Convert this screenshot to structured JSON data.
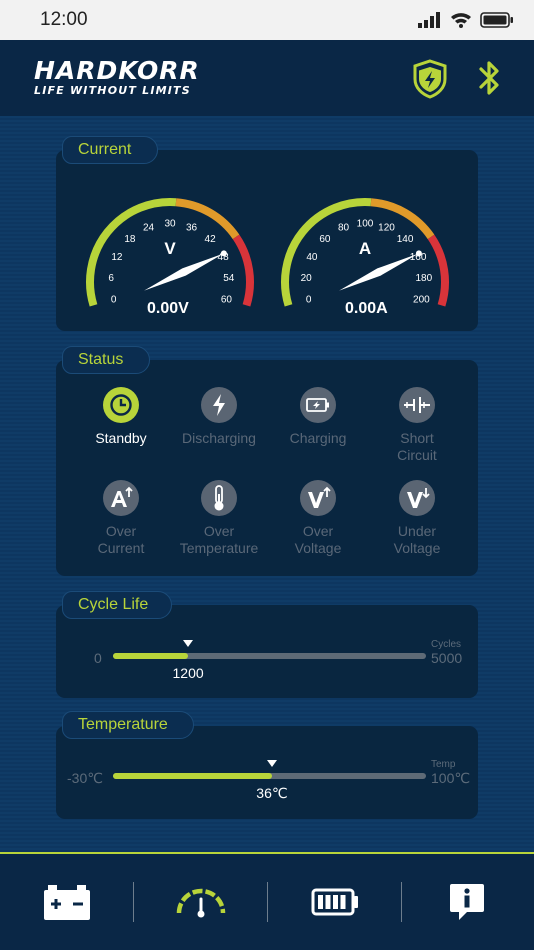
{
  "status_bar": {
    "time": "12:00"
  },
  "header": {
    "brand": "HARDKORR",
    "tagline": "LIFE WITHOUT LIMITS",
    "icons": [
      "shield-bolt-icon",
      "bluetooth-icon"
    ],
    "accent": "#b8d43a"
  },
  "current": {
    "title": "Current",
    "voltage": {
      "unit": "V",
      "ticks": [
        "0",
        "6",
        "12",
        "18",
        "24",
        "30",
        "36",
        "42",
        "48",
        "54",
        "60"
      ],
      "value": 0,
      "max": 60,
      "readout": "0.00V"
    },
    "amperage": {
      "unit": "A",
      "ticks": [
        "0",
        "20",
        "40",
        "60",
        "80",
        "100",
        "120",
        "140",
        "160",
        "180",
        "200"
      ],
      "value": 0,
      "max": 200,
      "readout": "0.00A"
    },
    "zone_colors": {
      "low": "#b8d43a",
      "mid": "#e09a2a",
      "high": "#d8343a"
    }
  },
  "status": {
    "title": "Status",
    "items": [
      {
        "label": "Standby",
        "icon": "clock-icon",
        "active": true
      },
      {
        "label": "Discharging",
        "icon": "lightning-icon",
        "active": false
      },
      {
        "label": "Charging",
        "icon": "battery-charging-icon",
        "active": false
      },
      {
        "label": "Short",
        "label2": "Circuit",
        "icon": "short-circuit-icon",
        "active": false
      },
      {
        "label": "Over",
        "label2": "Current",
        "icon": "over-current-icon",
        "active": false
      },
      {
        "label": "Over",
        "label2": "Temperature",
        "icon": "thermometer-icon",
        "active": false
      },
      {
        "label": "Over",
        "label2": "Voltage",
        "icon": "over-voltage-icon",
        "active": false
      },
      {
        "label": "Under",
        "label2": "Voltage",
        "icon": "under-voltage-icon",
        "active": false
      }
    ]
  },
  "cycle_life": {
    "title": "Cycle Life",
    "min_label": "0",
    "max_label": "5000",
    "unit_label": "Cycles",
    "value": 1200,
    "value_label": "1200",
    "min": 0,
    "max": 5000
  },
  "temperature": {
    "title": "Temperature",
    "min_label": "-30℃",
    "max_label": "100℃",
    "unit_label": "Temp",
    "value": 36,
    "value_label": "36℃",
    "min": -30,
    "max": 100
  },
  "bottom_nav": [
    {
      "icon": "car-battery-icon",
      "active": false
    },
    {
      "icon": "gauge-icon",
      "active": true
    },
    {
      "icon": "battery-level-icon",
      "active": false
    },
    {
      "icon": "info-icon",
      "active": false
    }
  ]
}
